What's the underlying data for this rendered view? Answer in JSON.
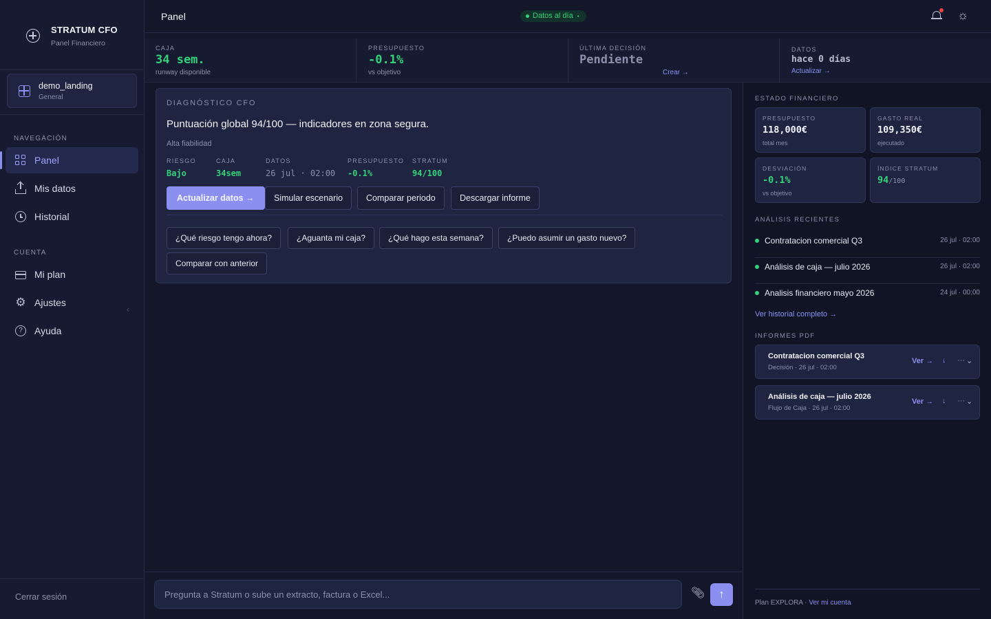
{
  "brand": {
    "title": "STRATUM CFO",
    "subtitle": "Panel Financiero"
  },
  "workspace": {
    "name": "demo_landing",
    "sub": "General"
  },
  "nav": {
    "section_nav": "NAVEGACIÓN",
    "items": [
      {
        "label": "Panel",
        "icon": "grid-icon",
        "active": true
      },
      {
        "label": "Mis datos",
        "icon": "upload-icon"
      },
      {
        "label": "Historial",
        "icon": "clock-icon"
      }
    ],
    "section_account": "CUENTA",
    "account_items": [
      {
        "label": "Mi plan",
        "icon": "credit-card-icon"
      },
      {
        "label": "Ajustes",
        "icon": "gear-icon"
      },
      {
        "label": "Ayuda",
        "icon": "help-icon"
      }
    ],
    "logout": "Cerrar sesión"
  },
  "topbar": {
    "title": "Panel",
    "status": "Datos al día",
    "status_tail": "•"
  },
  "kpis": {
    "caja": {
      "label": "CAJA",
      "value": "34 sem.",
      "sub": "runway disponible"
    },
    "presupuesto": {
      "label": "PRESUPUESTO",
      "value": "-0.1%",
      "sub": "vs objetivo"
    },
    "decision": {
      "label": "ÚLTIMA DECISIÓN",
      "value": "Pendiente",
      "link": "Crear →"
    },
    "datos": {
      "label": "DATOS",
      "value": "hace 0 días",
      "link": "Actualizar →"
    }
  },
  "diagnostic": {
    "label": "DIAGNÓSTICO CFO",
    "headline": "Puntuación global 94/100 — indicadores en zona segura.",
    "reliability": "Alta fiabilidad",
    "metrics": [
      {
        "label": "RIESGO",
        "value": "Bajo"
      },
      {
        "label": "CAJA",
        "value": "34sem"
      },
      {
        "label": "DATOS",
        "value": "26 jul · 02:00"
      },
      {
        "label": "PRESUPUESTO",
        "value": "-0.1%"
      },
      {
        "label": "STRATUM",
        "value": "94/100"
      }
    ],
    "actions": [
      "Actualizar datos →",
      "Simular escenario",
      "Comparar periodo",
      "Descargar informe"
    ],
    "questions": [
      "¿Qué riesgo tengo ahora?",
      "¿Aguanta mi caja?",
      "¿Qué hago esta semana?",
      "¿Puedo asumir un gasto nuevo?",
      "Comparar con anterior"
    ]
  },
  "composer": {
    "placeholder": "Pregunta a Stratum o sube un extracto, factura o Excel..."
  },
  "right": {
    "estado_label": "ESTADO FINANCIERO",
    "tiles": [
      {
        "label": "PRESUPUESTO",
        "value": "118,000€",
        "sub": "total mes"
      },
      {
        "label": "GASTO REAL",
        "value": "109,350€",
        "sub": "ejecutado"
      },
      {
        "label": "DESVIACIÓN",
        "value": "-0.1%",
        "sub": "vs objetivo"
      },
      {
        "label": "ÍNDICE STRATUM",
        "value": "94",
        "value_suffix": "/100",
        "sub": ""
      }
    ],
    "recent_label": "ANÁLISIS RECIENTES",
    "recent": [
      {
        "title": "Contratacion comercial Q3",
        "time": "26 jul · 02:00"
      },
      {
        "title": "Análisis de caja — julio 2026",
        "time": "26 jul · 02:00"
      },
      {
        "title": "Analisis financiero mayo 2026",
        "time": "24 jul · 00:00"
      }
    ],
    "history_link": "Ver historial completo →",
    "pdf_label": "INFORMES PDF",
    "reports": [
      {
        "title": "Contratacion comercial Q3",
        "meta": "Decisión · 26 jul · 02:00",
        "view": "Ver →",
        "download": "↓",
        "more": "···",
        "chevron": "⌄"
      },
      {
        "title": "Análisis de caja — julio 2026",
        "meta": "Flujo de Caja · 26 jul · 02:00",
        "view": "Ver →",
        "download": "↓",
        "more": "···",
        "chevron": "⌄"
      }
    ],
    "footer_plan": "Plan EXPLORA · ",
    "footer_link": "Ver mi cuenta"
  },
  "colors": {
    "accent": "#8a8ff0",
    "positive": "#34d27a",
    "background": "#14172a",
    "panel": "#1f2440"
  }
}
